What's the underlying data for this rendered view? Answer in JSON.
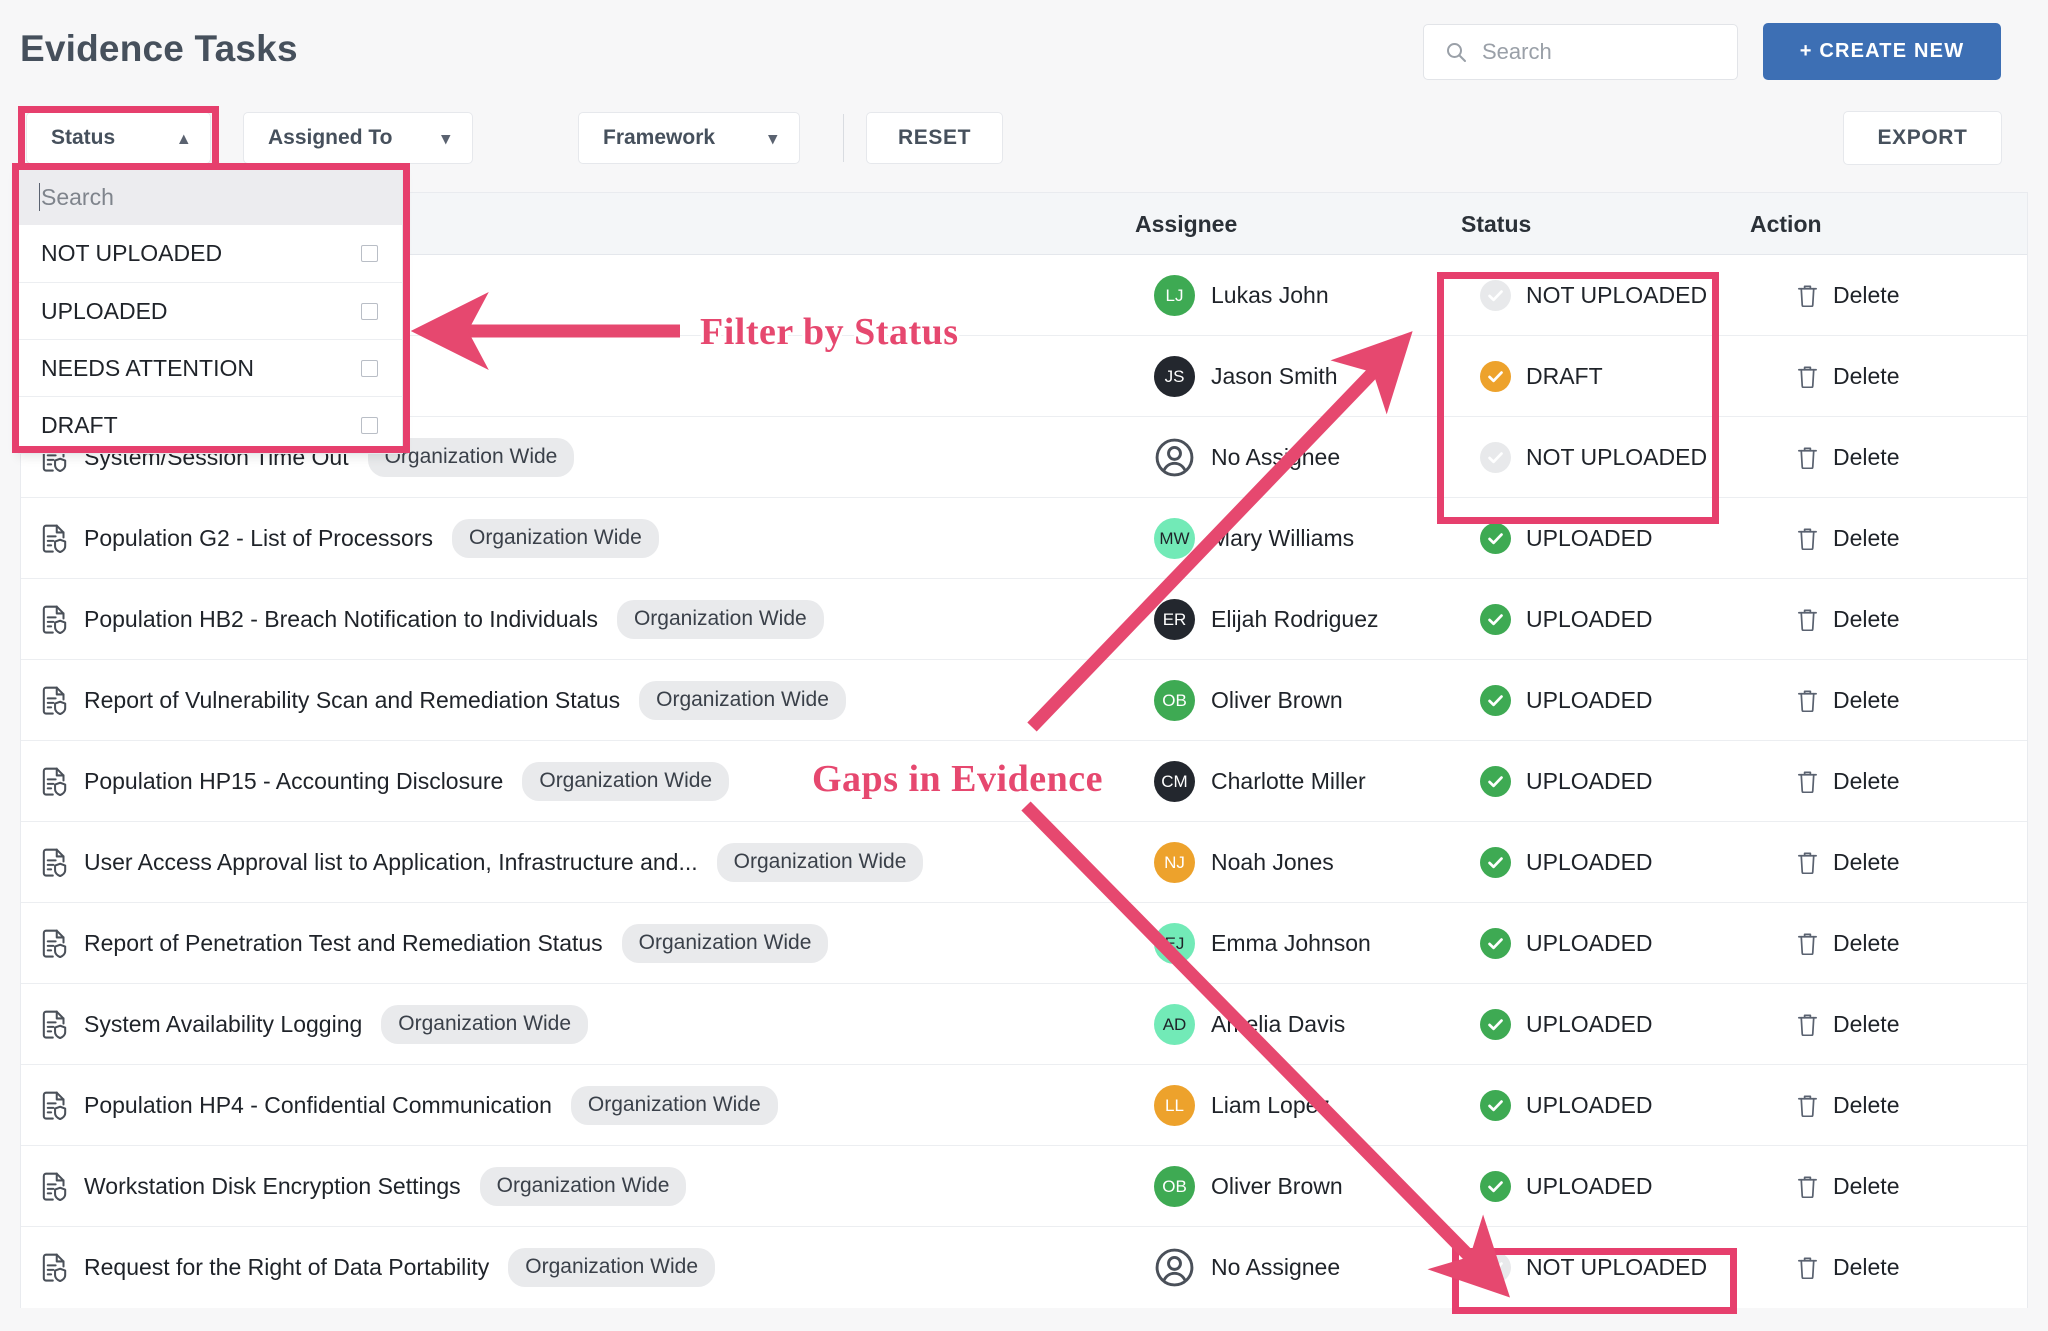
{
  "header": {
    "title": "Evidence Tasks",
    "search": {
      "placeholder": "Search",
      "icon": "search-icon"
    },
    "create_button": "+ CREATE NEW"
  },
  "filters": {
    "status": {
      "label": "Status",
      "chevron": "chevron-up-icon",
      "open": true
    },
    "assigned_to": {
      "label": "Assigned To",
      "chevron": "chevron-down-icon"
    },
    "framework": {
      "label": "Framework",
      "chevron": "chevron-down-icon"
    },
    "reset": "RESET",
    "export": "EXPORT"
  },
  "status_dropdown": {
    "search_placeholder": "Search",
    "options": [
      {
        "label": "NOT UPLOADED",
        "checked": false
      },
      {
        "label": "UPLOADED",
        "checked": false
      },
      {
        "label": "NEEDS ATTENTION",
        "checked": false
      },
      {
        "label": "DRAFT",
        "checked": false
      }
    ]
  },
  "table": {
    "columns": [
      "",
      "Assignee",
      "Status",
      "Action"
    ],
    "action_label": "Delete",
    "action_icon": "trash-icon",
    "no_assignee_label": "No Assignee",
    "rows": [
      {
        "title": "",
        "scope": "",
        "hidden_behind_dropdown": true,
        "assignee": {
          "name": "Lukas John",
          "initials": "LJ",
          "color": "#3eaa53"
        },
        "status": {
          "label": "NOT UPLOADED",
          "color": "#e4e6e8",
          "kind": "not-uploaded"
        }
      },
      {
        "title": "",
        "scope": "",
        "hidden_behind_dropdown": true,
        "assignee": {
          "name": "Jason Smith",
          "initials": "JS",
          "color": "#23272e"
        },
        "status": {
          "label": "DRAFT",
          "color": "#eda22c",
          "kind": "draft"
        }
      },
      {
        "title": "System/Session Time Out",
        "scope": "Organization Wide",
        "assignee": {
          "name": "No Assignee",
          "initials": "",
          "color": "none"
        },
        "status": {
          "label": "NOT UPLOADED",
          "color": "#e4e6e8",
          "kind": "not-uploaded"
        }
      },
      {
        "title": "Population G2 - List of Processors",
        "scope": "Organization Wide",
        "assignee": {
          "name": "Mary Williams",
          "initials": "MW",
          "color": "#72eab7"
        },
        "status": {
          "label": "UPLOADED",
          "color": "#3eaa53",
          "kind": "uploaded"
        }
      },
      {
        "title": "Population HB2 - Breach Notification to Individuals",
        "scope": "Organization Wide",
        "assignee": {
          "name": "Elijah Rodriguez",
          "initials": "ER",
          "color": "#23272e"
        },
        "status": {
          "label": "UPLOADED",
          "color": "#3eaa53",
          "kind": "uploaded"
        }
      },
      {
        "title": "Report of Vulnerability Scan and Remediation Status",
        "scope": "Organization Wide",
        "assignee": {
          "name": "Oliver Brown",
          "initials": "OB",
          "color": "#3eaa53"
        },
        "status": {
          "label": "UPLOADED",
          "color": "#3eaa53",
          "kind": "uploaded"
        }
      },
      {
        "title": "Population HP15 - Accounting Disclosure",
        "scope": "Organization Wide",
        "assignee": {
          "name": "Charlotte Miller",
          "initials": "CM",
          "color": "#23272e"
        },
        "status": {
          "label": "UPLOADED",
          "color": "#3eaa53",
          "kind": "uploaded"
        }
      },
      {
        "title": "User Access Approval list to Application, Infrastructure and...",
        "scope": "Organization Wide",
        "assignee": {
          "name": "Noah Jones",
          "initials": "NJ",
          "color": "#eda22c"
        },
        "status": {
          "label": "UPLOADED",
          "color": "#3eaa53",
          "kind": "uploaded"
        }
      },
      {
        "title": "Report of Penetration Test and Remediation Status",
        "scope": "Organization Wide",
        "assignee": {
          "name": "Emma Johnson",
          "initials": "EJ",
          "color": "#72eab7"
        },
        "status": {
          "label": "UPLOADED",
          "color": "#3eaa53",
          "kind": "uploaded"
        }
      },
      {
        "title": "System Availability Logging",
        "scope": "Organization Wide",
        "assignee": {
          "name": "Amelia Davis",
          "initials": "AD",
          "color": "#72eab7"
        },
        "status": {
          "label": "UPLOADED",
          "color": "#3eaa53",
          "kind": "uploaded"
        }
      },
      {
        "title": "Population HP4 - Confidential Communication",
        "scope": "Organization Wide",
        "assignee": {
          "name": "Liam Lopez",
          "initials": "LL",
          "color": "#eda22c"
        },
        "status": {
          "label": "UPLOADED",
          "color": "#3eaa53",
          "kind": "uploaded"
        }
      },
      {
        "title": "Workstation Disk Encryption Settings",
        "scope": "Organization Wide",
        "assignee": {
          "name": "Oliver Brown",
          "initials": "OB",
          "color": "#3eaa53"
        },
        "status": {
          "label": "UPLOADED",
          "color": "#3eaa53",
          "kind": "uploaded"
        }
      },
      {
        "title": "Request for the Right of Data Portability",
        "scope": "Organization Wide",
        "assignee": {
          "name": "No Assignee",
          "initials": "",
          "color": "none"
        },
        "status": {
          "label": "NOT UPLOADED",
          "color": "#e4e6e8",
          "kind": "not-uploaded"
        }
      }
    ]
  },
  "annotations": {
    "accent_color": "#e6486f",
    "filter_note": "Filter by Status",
    "gaps_note": "Gaps in Evidence"
  }
}
